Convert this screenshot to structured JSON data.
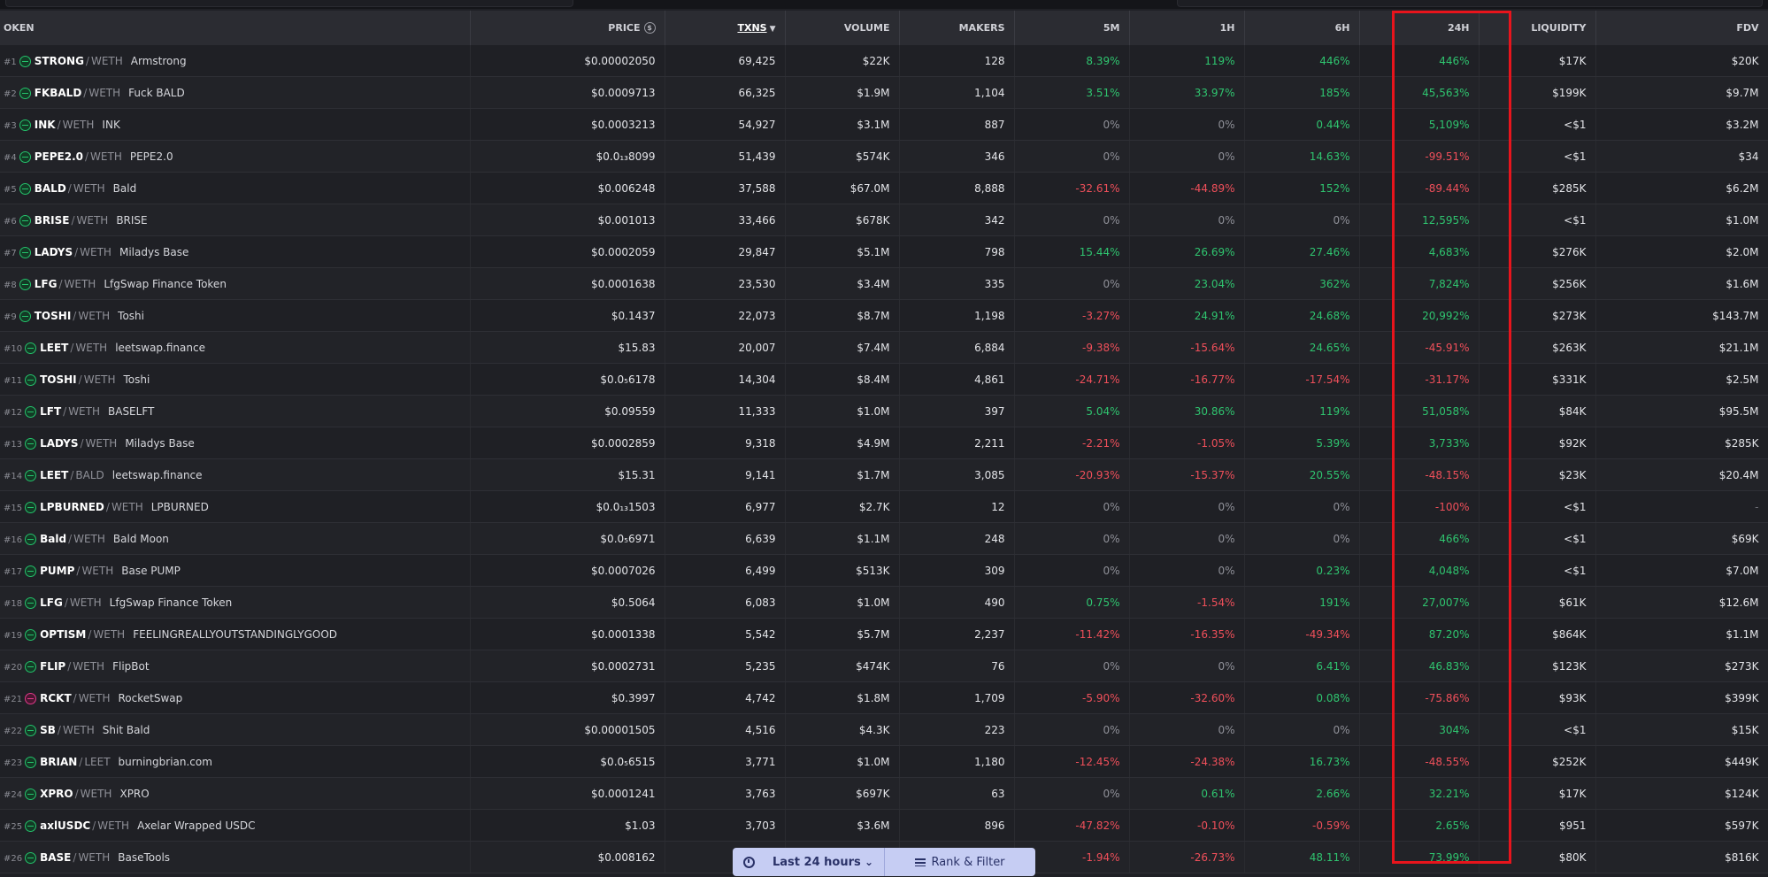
{
  "columns": {
    "token": "OKEN",
    "price": "PRICE",
    "txns": "TXNS",
    "volume": "VOLUME",
    "makers": "MAKERS",
    "m5": "5M",
    "h1": "1H",
    "h6": "6H",
    "h24": "24H",
    "liquidity": "LIQUIDITY",
    "fdv": "FDV"
  },
  "rows": [
    {
      "rank": "#1",
      "symbol": "STRONG",
      "quote": "WETH",
      "name": "Armstrong",
      "price": "$0.00002050",
      "txns": "69,425",
      "volume": "$22K",
      "makers": "128",
      "m5": "8.39%",
      "h1": "119%",
      "h6": "446%",
      "h24": "446%",
      "liquidity": "$17K",
      "fdv": "$20K"
    },
    {
      "rank": "#2",
      "symbol": "FKBALD",
      "quote": "WETH",
      "name": "Fuck BALD",
      "price": "$0.0009713",
      "txns": "66,325",
      "volume": "$1.9M",
      "makers": "1,104",
      "m5": "3.51%",
      "h1": "33.97%",
      "h6": "185%",
      "h24": "45,563%",
      "liquidity": "$199K",
      "fdv": "$9.7M"
    },
    {
      "rank": "#3",
      "symbol": "INK",
      "quote": "WETH",
      "name": "INK",
      "price": "$0.0003213",
      "txns": "54,927",
      "volume": "$3.1M",
      "makers": "887",
      "m5": "0%",
      "h1": "0%",
      "h6": "0.44%",
      "h24": "5,109%",
      "liquidity": "<$1",
      "fdv": "$3.2M"
    },
    {
      "rank": "#4",
      "symbol": "PEPE2.0",
      "quote": "WETH",
      "name": "PEPE2.0",
      "price": "$0.0₁₃8099",
      "txns": "51,439",
      "volume": "$574K",
      "makers": "346",
      "m5": "0%",
      "h1": "0%",
      "h6": "14.63%",
      "h24": "-99.51%",
      "liquidity": "<$1",
      "fdv": "$34"
    },
    {
      "rank": "#5",
      "symbol": "BALD",
      "quote": "WETH",
      "name": "Bald",
      "price": "$0.006248",
      "txns": "37,588",
      "volume": "$67.0M",
      "makers": "8,888",
      "m5": "-32.61%",
      "h1": "-44.89%",
      "h6": "152%",
      "h24": "-89.44%",
      "liquidity": "$285K",
      "fdv": "$6.2M"
    },
    {
      "rank": "#6",
      "symbol": "BRISE",
      "quote": "WETH",
      "name": "BRISE",
      "price": "$0.001013",
      "txns": "33,466",
      "volume": "$678K",
      "makers": "342",
      "m5": "0%",
      "h1": "0%",
      "h6": "0%",
      "h24": "12,595%",
      "liquidity": "<$1",
      "fdv": "$1.0M"
    },
    {
      "rank": "#7",
      "symbol": "LADYS",
      "quote": "WETH",
      "name": "Miladys Base",
      "price": "$0.0002059",
      "txns": "29,847",
      "volume": "$5.1M",
      "makers": "798",
      "m5": "15.44%",
      "h1": "26.69%",
      "h6": "27.46%",
      "h24": "4,683%",
      "liquidity": "$276K",
      "fdv": "$2.0M"
    },
    {
      "rank": "#8",
      "symbol": "LFG",
      "quote": "WETH",
      "name": "LfgSwap Finance Token",
      "price": "$0.0001638",
      "txns": "23,530",
      "volume": "$3.4M",
      "makers": "335",
      "m5": "0%",
      "h1": "23.04%",
      "h6": "362%",
      "h24": "7,824%",
      "liquidity": "$256K",
      "fdv": "$1.6M"
    },
    {
      "rank": "#9",
      "symbol": "TOSHI",
      "quote": "WETH",
      "name": "Toshi",
      "price": "$0.1437",
      "txns": "22,073",
      "volume": "$8.7M",
      "makers": "1,198",
      "m5": "-3.27%",
      "h1": "24.91%",
      "h6": "24.68%",
      "h24": "20,992%",
      "liquidity": "$273K",
      "fdv": "$143.7M"
    },
    {
      "rank": "#10",
      "symbol": "LEET",
      "quote": "WETH",
      "name": "leetswap.finance",
      "price": "$15.83",
      "txns": "20,007",
      "volume": "$7.4M",
      "makers": "6,884",
      "m5": "-9.38%",
      "h1": "-15.64%",
      "h6": "24.65%",
      "h24": "-45.91%",
      "liquidity": "$263K",
      "fdv": "$21.1M"
    },
    {
      "rank": "#11",
      "symbol": "TOSHI",
      "quote": "WETH",
      "name": "Toshi",
      "price": "$0.0₅6178",
      "txns": "14,304",
      "volume": "$8.4M",
      "makers": "4,861",
      "m5": "-24.71%",
      "h1": "-16.77%",
      "h6": "-17.54%",
      "h24": "-31.17%",
      "liquidity": "$331K",
      "fdv": "$2.5M"
    },
    {
      "rank": "#12",
      "symbol": "LFT",
      "quote": "WETH",
      "name": "BASELFT",
      "price": "$0.09559",
      "txns": "11,333",
      "volume": "$1.0M",
      "makers": "397",
      "m5": "5.04%",
      "h1": "30.86%",
      "h6": "119%",
      "h24": "51,058%",
      "liquidity": "$84K",
      "fdv": "$95.5M"
    },
    {
      "rank": "#13",
      "symbol": "LADYS",
      "quote": "WETH",
      "name": "Miladys Base",
      "price": "$0.0002859",
      "txns": "9,318",
      "volume": "$4.9M",
      "makers": "2,211",
      "m5": "-2.21%",
      "h1": "-1.05%",
      "h6": "5.39%",
      "h24": "3,733%",
      "liquidity": "$92K",
      "fdv": "$285K"
    },
    {
      "rank": "#14",
      "symbol": "LEET",
      "quote": "BALD",
      "name": "leetswap.finance",
      "price": "$15.31",
      "txns": "9,141",
      "volume": "$1.7M",
      "makers": "3,085",
      "m5": "-20.93%",
      "h1": "-15.37%",
      "h6": "20.55%",
      "h24": "-48.15%",
      "liquidity": "$23K",
      "fdv": "$20.4M"
    },
    {
      "rank": "#15",
      "symbol": "LPBURNED",
      "quote": "WETH",
      "name": "LPBURNED",
      "price": "$0.0₁₃1503",
      "txns": "6,977",
      "volume": "$2.7K",
      "makers": "12",
      "m5": "0%",
      "h1": "0%",
      "h6": "0%",
      "h24": "-100%",
      "liquidity": "<$1",
      "fdv": "-"
    },
    {
      "rank": "#16",
      "symbol": "Bald",
      "quote": "WETH",
      "name": "Bald Moon",
      "price": "$0.0₅6971",
      "txns": "6,639",
      "volume": "$1.1M",
      "makers": "248",
      "m5": "0%",
      "h1": "0%",
      "h6": "0%",
      "h24": "466%",
      "liquidity": "<$1",
      "fdv": "$69K"
    },
    {
      "rank": "#17",
      "symbol": "PUMP",
      "quote": "WETH",
      "name": "Base PUMP",
      "price": "$0.0007026",
      "txns": "6,499",
      "volume": "$513K",
      "makers": "309",
      "m5": "0%",
      "h1": "0%",
      "h6": "0.23%",
      "h24": "4,048%",
      "liquidity": "<$1",
      "fdv": "$7.0M"
    },
    {
      "rank": "#18",
      "symbol": "LFG",
      "quote": "WETH",
      "name": "LfgSwap Finance Token",
      "price": "$0.5064",
      "txns": "6,083",
      "volume": "$1.0M",
      "makers": "490",
      "m5": "0.75%",
      "h1": "-1.54%",
      "h6": "191%",
      "h24": "27,007%",
      "liquidity": "$61K",
      "fdv": "$12.6M"
    },
    {
      "rank": "#19",
      "symbol": "OPTISM",
      "quote": "WETH",
      "name": "FEELINGREALLYOUTSTANDINGLYGOOD",
      "price": "$0.0001338",
      "txns": "5,542",
      "volume": "$5.7M",
      "makers": "2,237",
      "m5": "-11.42%",
      "h1": "-16.35%",
      "h6": "-49.34%",
      "h24": "87.20%",
      "liquidity": "$864K",
      "fdv": "$1.1M"
    },
    {
      "rank": "#20",
      "symbol": "FLIP",
      "quote": "WETH",
      "name": "FlipBot",
      "price": "$0.0002731",
      "txns": "5,235",
      "volume": "$474K",
      "makers": "76",
      "m5": "0%",
      "h1": "0%",
      "h6": "6.41%",
      "h24": "46.83%",
      "liquidity": "$123K",
      "fdv": "$273K"
    },
    {
      "rank": "#21",
      "symbol": "RCKT",
      "quote": "WETH",
      "name": "RocketSwap",
      "price": "$0.3997",
      "txns": "4,742",
      "volume": "$1.8M",
      "makers": "1,709",
      "m5": "-5.90%",
      "h1": "-32.60%",
      "h6": "0.08%",
      "h24": "-75.86%",
      "liquidity": "$93K",
      "fdv": "$399K",
      "alt_icon": true
    },
    {
      "rank": "#22",
      "symbol": "SB",
      "quote": "WETH",
      "name": "Shit Bald",
      "price": "$0.00001505",
      "txns": "4,516",
      "volume": "$4.3K",
      "makers": "223",
      "m5": "0%",
      "h1": "0%",
      "h6": "0%",
      "h24": "304%",
      "liquidity": "<$1",
      "fdv": "$15K"
    },
    {
      "rank": "#23",
      "symbol": "BRIAN",
      "quote": "LEET",
      "name": "burningbrian.com",
      "price": "$0.0₅6515",
      "txns": "3,771",
      "volume": "$1.0M",
      "makers": "1,180",
      "m5": "-12.45%",
      "h1": "-24.38%",
      "h6": "16.73%",
      "h24": "-48.55%",
      "liquidity": "$252K",
      "fdv": "$449K"
    },
    {
      "rank": "#24",
      "symbol": "XPRO",
      "quote": "WETH",
      "name": "XPRO",
      "price": "$0.0001241",
      "txns": "3,763",
      "volume": "$697K",
      "makers": "63",
      "m5": "0%",
      "h1": "0.61%",
      "h6": "2.66%",
      "h24": "32.21%",
      "liquidity": "$17K",
      "fdv": "$124K"
    },
    {
      "rank": "#25",
      "symbol": "axlUSDC",
      "quote": "WETH",
      "name": "Axelar Wrapped USDC",
      "price": "$1.03",
      "txns": "3,703",
      "volume": "$3.6M",
      "makers": "896",
      "m5": "-47.82%",
      "h1": "-0.10%",
      "h6": "-0.59%",
      "h24": "2.65%",
      "liquidity": "$951",
      "fdv": "$597K"
    },
    {
      "rank": "#26",
      "symbol": "BASE",
      "quote": "WETH",
      "name": "BaseTools",
      "price": "$0.008162",
      "txns": "",
      "volume": "",
      "makers": "",
      "m5": "-1.94%",
      "h1": "-26.73%",
      "h6": "48.11%",
      "h24": "73.99%",
      "liquidity": "$80K",
      "fdv": "$816K"
    }
  ],
  "bottom_bar": {
    "time_label": "Last 24 hours",
    "filter_label": "Rank & Filter"
  },
  "icons": {
    "info": "dollar-info-icon",
    "sort": "sort-desc-icon",
    "clock": "clock-icon",
    "chevron": "chevron-down-icon",
    "filter": "filter-icon"
  },
  "colors": {
    "positive": "#2fc46f",
    "negative": "#ef4f5a",
    "neutral": "#8f9098",
    "highlight": "#e8141c",
    "bottom_bar": "#c6cdf3"
  }
}
